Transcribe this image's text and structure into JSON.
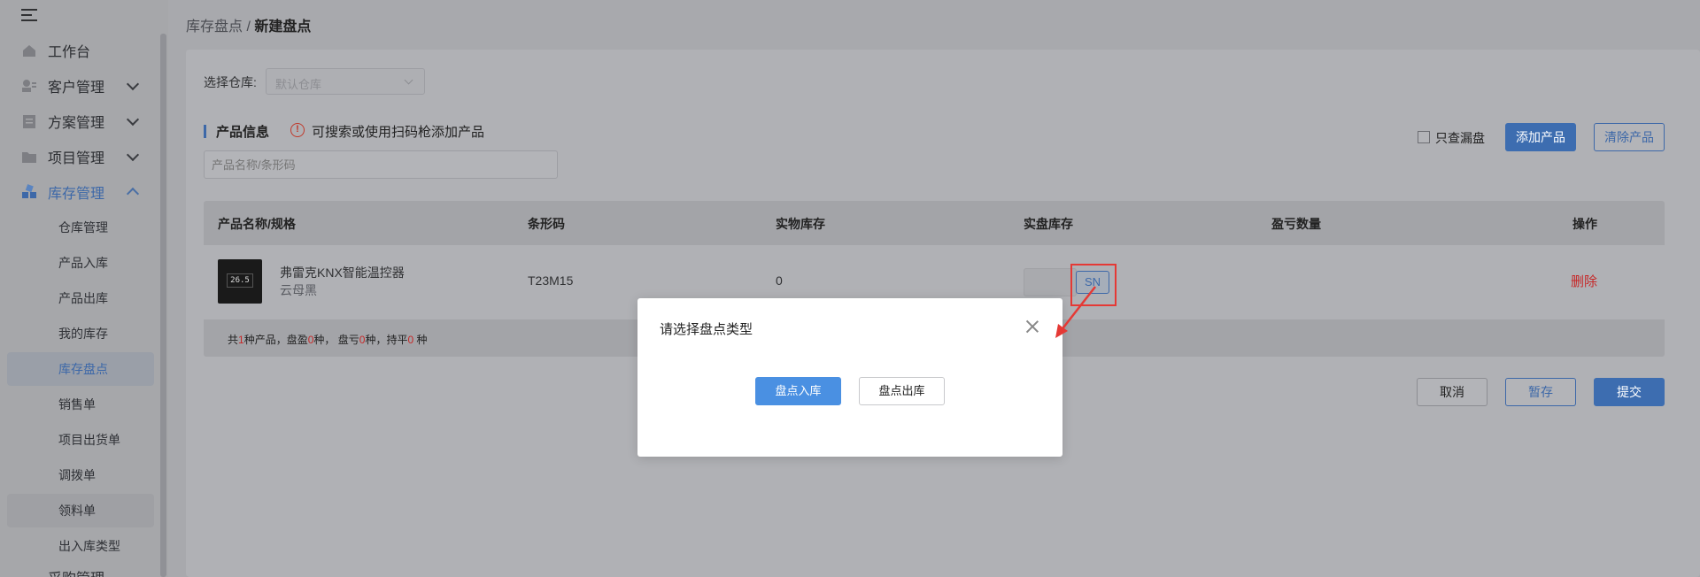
{
  "breadcrumb": {
    "parent": "库存盘点",
    "separator": "/",
    "current": "新建盘点"
  },
  "sidebar": {
    "items": [
      {
        "label": "工作台",
        "icon": "home-icon"
      },
      {
        "label": "客户管理",
        "icon": "customer-icon"
      },
      {
        "label": "方案管理",
        "icon": "document-icon"
      },
      {
        "label": "项目管理",
        "icon": "folder-icon"
      },
      {
        "label": "库存管理",
        "icon": "inventory-icon"
      }
    ],
    "sub_items": [
      {
        "label": "仓库管理"
      },
      {
        "label": "产品入库"
      },
      {
        "label": "产品出库"
      },
      {
        "label": "我的库存"
      },
      {
        "label": "库存盘点"
      },
      {
        "label": "销售单"
      },
      {
        "label": "项目出货单"
      },
      {
        "label": "调拨单"
      },
      {
        "label": "领料单"
      },
      {
        "label": "出入库类型"
      }
    ],
    "cut_off_item": "采购管理"
  },
  "warehouse": {
    "label": "选择仓库:",
    "placeholder": "默认仓库"
  },
  "product_info": {
    "title": "产品信息",
    "hint": "可搜索或使用扫码枪添加产品",
    "search_placeholder": "产品名称/条形码",
    "only_missing_label": "只查漏盘",
    "add_button": "添加产品",
    "clear_button": "清除产品"
  },
  "table": {
    "headers": [
      "产品名称/规格",
      "条形码",
      "实物库存",
      "实盘库存",
      "盈亏数量",
      "操作"
    ],
    "rows": [
      {
        "name": "弗雷克KNX智能温控器",
        "spec": "云母黑",
        "barcode": "T23M15",
        "stock": "0",
        "sn_label": "SN",
        "delete_label": "删除",
        "thumb_text": "26.5"
      }
    ],
    "summary": {
      "p1": "共",
      "count": "1",
      "p2": "种产品，盘盈",
      "gain": "0",
      "p3": "种，  盘亏",
      "loss": "0",
      "p4": "种，持平",
      "even": "0",
      "p5": " 种"
    }
  },
  "actions": {
    "cancel": "取消",
    "save": "暂存",
    "submit": "提交"
  },
  "modal": {
    "title": "请选择盘点类型",
    "primary": "盘点入库",
    "secondary": "盘点出库"
  },
  "colors": {
    "accent": "#3d68a8",
    "danger": "#c62828",
    "modal_primary": "#4a90e2",
    "highlight": "#e53935"
  }
}
